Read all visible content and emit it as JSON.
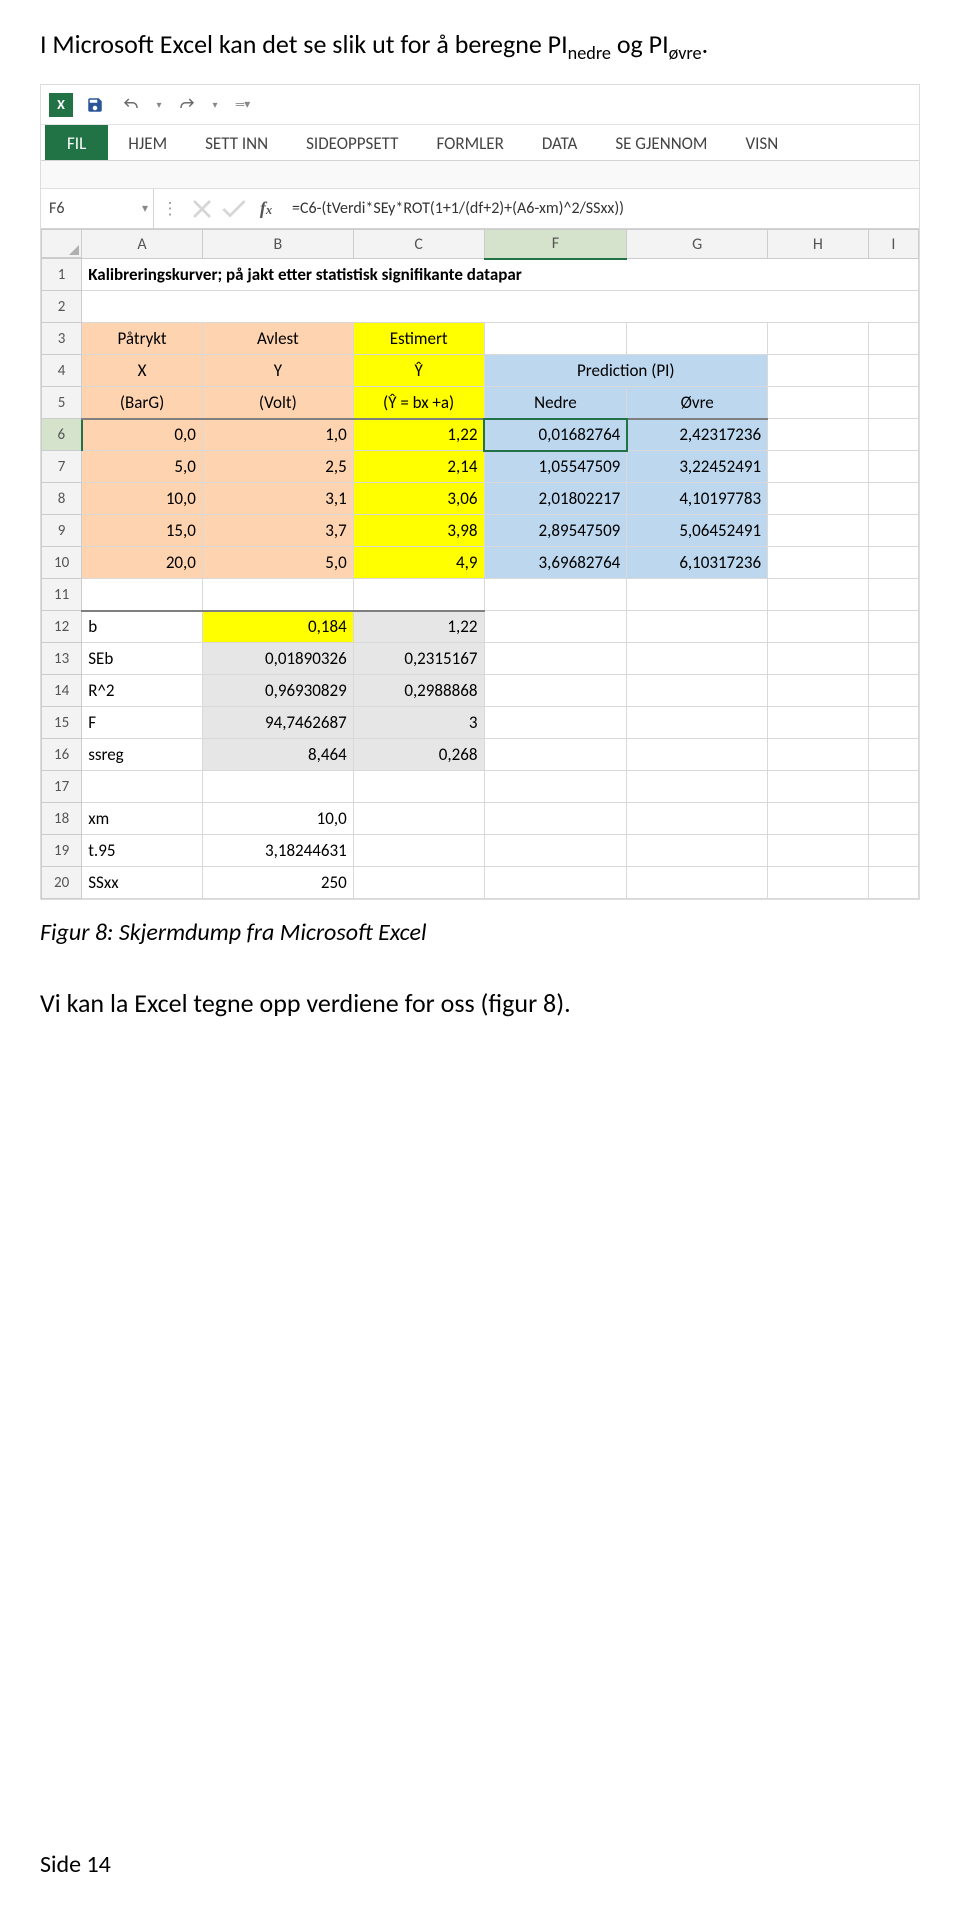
{
  "intro": {
    "pre": "I Microsoft Excel kan det se slik ut for å beregne PI",
    "nedre": "nedre",
    "and": " og PI",
    "ovre": "øvre",
    "post": "."
  },
  "ribbon": {
    "tabs": [
      "FIL",
      "HJEM",
      "SETT INN",
      "SIDEOPPSETT",
      "FORMLER",
      "DATA",
      "SE GJENNOM",
      "VISN"
    ]
  },
  "formula": {
    "namebox": "F6",
    "text": "=C6-(tVerdi*SEy*ROT(1+1/(df+2)+(A6-xm)^2/SSxx))"
  },
  "cols": [
    "A",
    "B",
    "C",
    "F",
    "G",
    "H",
    "I"
  ],
  "title_row": "Kalibreringskurver; på jakt etter statistisk signifikante datapar",
  "headers3": {
    "A": "Påtrykt",
    "B": "Avlest",
    "C": "Estimert"
  },
  "headers4": {
    "A": "X",
    "B": "Y",
    "C": "Ŷ",
    "FG": "Prediction (PI)"
  },
  "headers5": {
    "A": "(BarG)",
    "B": "(Volt)",
    "C": "(Ŷ = bx +a)",
    "F": "Nedre",
    "G": "Øvre"
  },
  "data_rows": [
    {
      "r": 6,
      "A": "0,0",
      "B": "1,0",
      "C": "1,22",
      "F": "0,01682764",
      "G": "2,42317236"
    },
    {
      "r": 7,
      "A": "5,0",
      "B": "2,5",
      "C": "2,14",
      "F": "1,05547509",
      "G": "3,22452491"
    },
    {
      "r": 8,
      "A": "10,0",
      "B": "3,1",
      "C": "3,06",
      "F": "2,01802217",
      "G": "4,10197783"
    },
    {
      "r": 9,
      "A": "15,0",
      "B": "3,7",
      "C": "3,98",
      "F": "2,89547509",
      "G": "5,06452491"
    },
    {
      "r": 10,
      "A": "20,0",
      "B": "5,0",
      "C": "4,9",
      "F": "3,69682764",
      "G": "6,10317236"
    }
  ],
  "stats_block": [
    {
      "r": 12,
      "A": "b",
      "B": "0,184",
      "C": "1,22",
      "B_yellow": true
    },
    {
      "r": 13,
      "A": "SEb",
      "B": "0,01890326",
      "C": "0,2315167"
    },
    {
      "r": 14,
      "A": "R^2",
      "B": "0,96930829",
      "C": "0,2988868"
    },
    {
      "r": 15,
      "A": "F",
      "B": "94,7462687",
      "C": "3"
    },
    {
      "r": 16,
      "A": "ssreg",
      "B": "8,464",
      "C": "0,268"
    }
  ],
  "extra": [
    {
      "r": 17,
      "A": ""
    },
    {
      "r": 18,
      "A": "xm",
      "B": "10,0"
    },
    {
      "r": 19,
      "A": "t.95",
      "B": "3,18244631"
    },
    {
      "r": 20,
      "A": "SSxx",
      "B": "250"
    }
  ],
  "caption": "Figur 8: Skjermdump fra Microsoft Excel",
  "body": "Vi kan la Excel tegne opp verdiene for oss (figur 8).",
  "footer": "Side 14"
}
